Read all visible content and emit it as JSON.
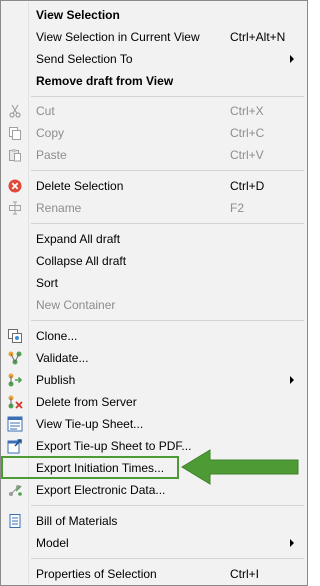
{
  "menu": {
    "items": [
      {
        "label": "View Selection",
        "bold": true
      },
      {
        "label": "View Selection in Current View",
        "shortcut": "Ctrl+Alt+N"
      },
      {
        "label": "Send Selection To",
        "submenu": true
      },
      {
        "label": "Remove draft from View",
        "bold": true
      },
      {
        "label": "Cut",
        "shortcut": "Ctrl+X",
        "disabled": true,
        "icon": "cut-icon"
      },
      {
        "label": "Copy",
        "shortcut": "Ctrl+C",
        "disabled": true,
        "icon": "copy-icon"
      },
      {
        "label": "Paste",
        "shortcut": "Ctrl+V",
        "disabled": true,
        "icon": "paste-icon"
      },
      {
        "label": "Delete Selection",
        "shortcut": "Ctrl+D",
        "icon": "delete-icon"
      },
      {
        "label": "Rename",
        "shortcut": "F2",
        "disabled": true,
        "icon": "rename-icon"
      },
      {
        "label": "Expand All draft"
      },
      {
        "label": "Collapse All draft"
      },
      {
        "label": "Sort"
      },
      {
        "label": "New Container",
        "disabled": true
      },
      {
        "label": "Clone...",
        "icon": "clone-icon"
      },
      {
        "label": "Validate...",
        "icon": "validate-icon"
      },
      {
        "label": "Publish",
        "submenu": true,
        "icon": "publish-icon"
      },
      {
        "label": "Delete from Server",
        "icon": "delete-server-icon"
      },
      {
        "label": "View Tie-up Sheet...",
        "icon": "view-sheet-icon"
      },
      {
        "label": "Export Tie-up Sheet to PDF...",
        "icon": "export-pdf-icon"
      },
      {
        "label": "Export Initiation Times..."
      },
      {
        "label": "Export Electronic Data...",
        "icon": "export-data-icon"
      },
      {
        "label": "Bill of Materials",
        "icon": "bill-icon"
      },
      {
        "label": "Model",
        "submenu": true
      },
      {
        "label": "Properties of Selection",
        "shortcut": "Ctrl+I"
      }
    ]
  },
  "colors": {
    "highlight": "#4e9a35",
    "disabled_text": "#8d8d8d",
    "menu_bg": "#f2f2f2"
  }
}
